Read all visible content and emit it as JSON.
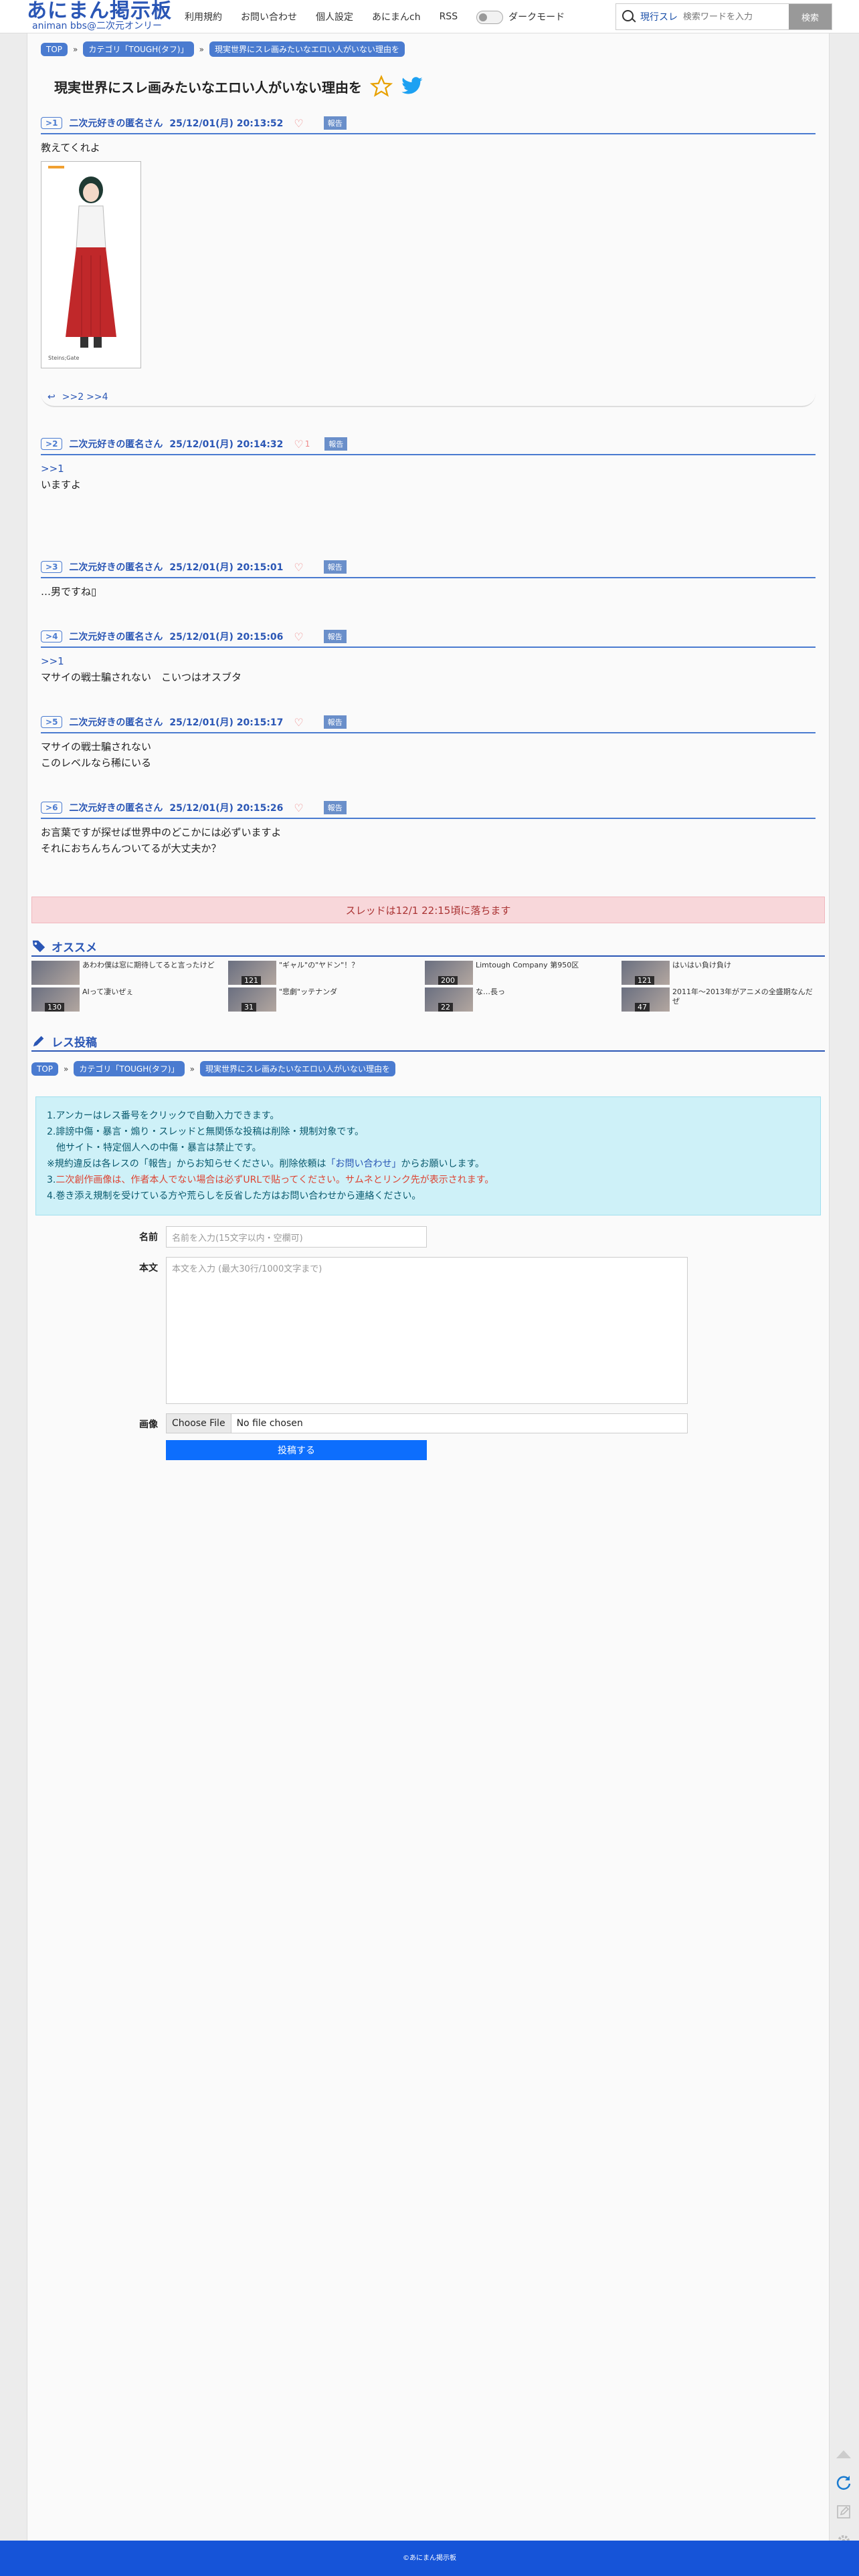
{
  "header": {
    "logo_main": "あにまん掲示板",
    "logo_sub": "animan bbs@二次元オンリー",
    "nav": [
      "利用規約",
      "お問い合わせ",
      "個人設定",
      "あにまんch",
      "RSS"
    ],
    "dark_mode": "ダークモード",
    "search_scope": "現行スレ",
    "search_placeholder": "検索ワードを入力",
    "search_button": "検索"
  },
  "breadcrumb": [
    "TOP",
    "カテゴリ「TOUGH(タフ)」",
    "現実世界にスレ画みたいなエロい人がいない理由を"
  ],
  "thread": {
    "title": "現実世界にスレ画みたいなエロい人がいない理由を"
  },
  "posts": [
    {
      "num": "1",
      "name": "二次元好きの匿名さん",
      "date": "25/12/01(月) 20:13:52",
      "likes": "",
      "report": "報告",
      "anchor": "",
      "lines": [
        "教えてくれよ"
      ],
      "replies": [
        ">>2",
        ">>4"
      ]
    },
    {
      "num": "2",
      "name": "二次元好きの匿名さん",
      "date": "25/12/01(月) 20:14:32",
      "likes": "1",
      "report": "報告",
      "anchor": ">>1",
      "lines": [
        "いますよ"
      ]
    },
    {
      "num": "3",
      "name": "二次元好きの匿名さん",
      "date": "25/12/01(月) 20:15:01",
      "likes": "",
      "report": "報告",
      "anchor": "",
      "lines": [
        "…男ですね▯"
      ]
    },
    {
      "num": "4",
      "name": "二次元好きの匿名さん",
      "date": "25/12/01(月) 20:15:06",
      "likes": "",
      "report": "報告",
      "anchor": ">>1",
      "lines": [
        "マサイの戦士騙されない　こいつはオスブタ"
      ]
    },
    {
      "num": "5",
      "name": "二次元好きの匿名さん",
      "date": "25/12/01(月) 20:15:17",
      "likes": "",
      "report": "報告",
      "anchor": "",
      "lines": [
        "マサイの戦士騙されない",
        "このレベルなら稀にいる"
      ]
    },
    {
      "num": "6",
      "name": "二次元好きの匿名さん",
      "date": "25/12/01(月) 20:15:26",
      "likes": "",
      "report": "報告",
      "anchor": "",
      "lines": [
        "お言葉ですが探せば世界中のどこかには必ずいますよ",
        "それにおちんちんついてるが大丈夫か？"
      ]
    }
  ],
  "dropped": "スレッドは12/1 22:15頃に落ちます",
  "recommend": {
    "heading": "オススメ",
    "items": [
      {
        "title": "あわわ僕は窓に期待してると言ったけど",
        "count": ""
      },
      {
        "title": "\"ギャル\"の\"ヤドン\"！？",
        "count": "121"
      },
      {
        "title": "Limtough Company 第950区",
        "count": "200"
      },
      {
        "title": "はいはい負け負け",
        "count": "121"
      },
      {
        "title": "AIって凄いぜぇ",
        "count": "130"
      },
      {
        "title": "\"悲劇\"ッテナンダ",
        "count": "31"
      },
      {
        "title": "な…長っ",
        "count": "22"
      },
      {
        "title": "2011年〜2013年がアニメの全盛期なんだぜ",
        "count": "47"
      }
    ]
  },
  "post_form": {
    "heading": "レス投稿",
    "notice_1": "1.アンカーはレス番号をクリックで自動入力できます。",
    "notice_2": "2.誹謗中傷・暴言・煽り・スレッドと無関係な投稿は削除・規制対象です。",
    "notice_2b": "　他サイト・特定個人への中傷・暴言は禁止です。",
    "notice_3a": "※規約違反は各レスの「報告」からお知らせください。削除依頼は",
    "notice_3link": "「お問い合わせ」",
    "notice_3b": "からお願いします。",
    "notice_4a": "3.",
    "notice_4red": "二次創作画像は、作者本人でない場合は必ずURLで貼ってください。サムネとリンク先が表示されます。",
    "notice_5": "4.巻き添え規制を受けている方や荒らしを反省した方はお問い合わせから連絡ください。",
    "name_label": "名前",
    "name_placeholder": "名前を入力(15文字以内・空欄可)",
    "body_label": "本文",
    "body_placeholder": "本文を入力 (最大30行/1000文字まで)",
    "image_label": "画像",
    "file_button": "Choose File",
    "file_status": "No file chosen",
    "submit": "投稿する"
  },
  "footer": "©あにまん掲示板"
}
